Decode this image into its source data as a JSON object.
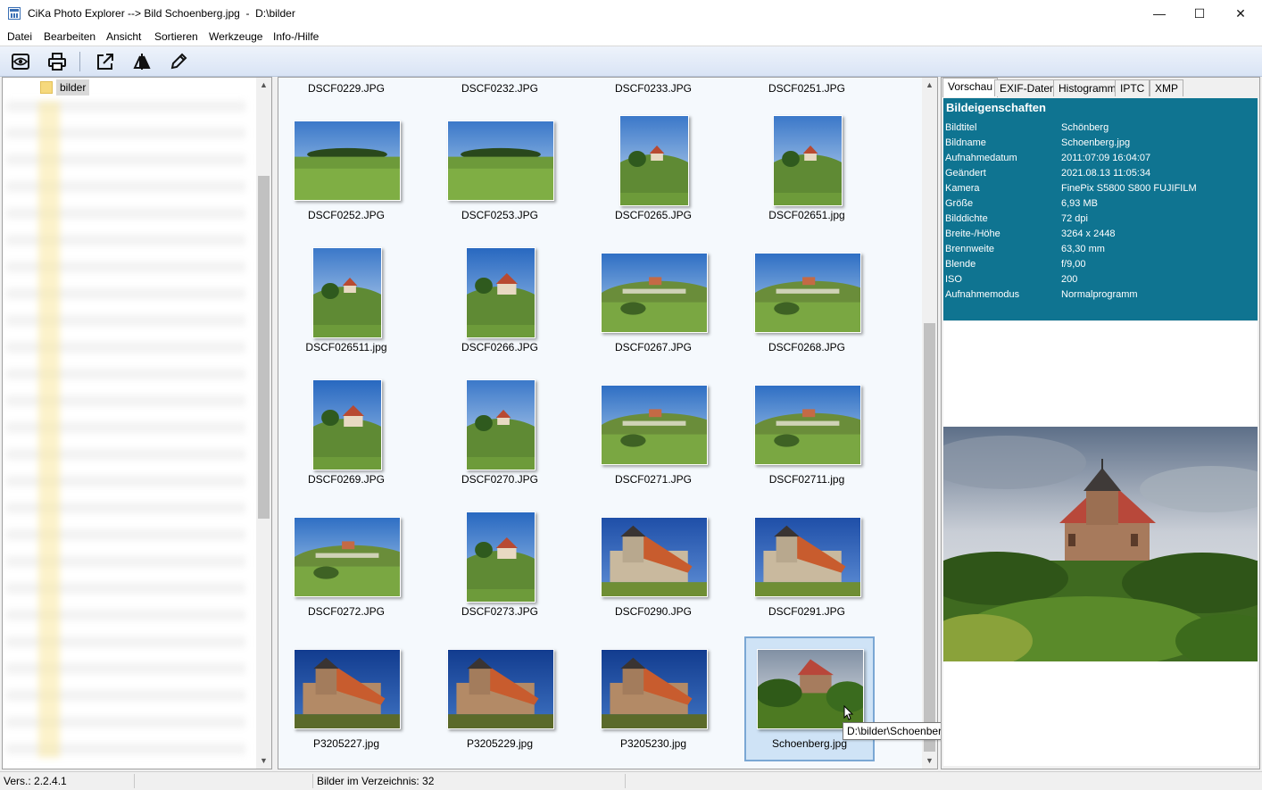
{
  "window": {
    "title": "CiKa Photo Explorer --> Bild Schoenberg.jpg  -  D:\\bilder",
    "minimize": "—",
    "maximize": "☐",
    "close": "✕"
  },
  "menu": [
    "Datei",
    "Bearbeiten",
    "Ansicht",
    "Sortieren",
    "Werkzeuge",
    "Info-/Hilfe"
  ],
  "toolbar": {
    "icons": [
      "eye-icon",
      "printer-icon",
      "external-link-icon",
      "compare-icon",
      "pencil-icon"
    ]
  },
  "tree": {
    "selected_folder": "bilder"
  },
  "grid": {
    "top_row_labels": [
      "DSCF0229.JPG",
      "DSCF0232.JPG",
      "DSCF0233.JPG",
      "DSCF0251.JPG"
    ],
    "rows": [
      [
        {
          "name": "DSCF0252.JPG",
          "scene": "hill"
        },
        {
          "name": "DSCF0253.JPG",
          "scene": "hill"
        },
        {
          "name": "DSCF0265.JPG",
          "scene": "chapel-hill"
        },
        {
          "name": "DSCF02651.jpg",
          "scene": "chapel-hill"
        }
      ],
      [
        {
          "name": "DSCF026511.jpg",
          "scene": "chapel-hill"
        },
        {
          "name": "DSCF0266.JPG",
          "scene": "chapel-close"
        },
        {
          "name": "DSCF0267.JPG",
          "scene": "village-meadow"
        },
        {
          "name": "DSCF0268.JPG",
          "scene": "village-meadow"
        }
      ],
      [
        {
          "name": "DSCF0269.JPG",
          "scene": "chapel-close"
        },
        {
          "name": "DSCF0270.JPG",
          "scene": "chapel-hill"
        },
        {
          "name": "DSCF0271.JPG",
          "scene": "village-meadow"
        },
        {
          "name": "DSCF02711.jpg",
          "scene": "village-meadow"
        }
      ],
      [
        {
          "name": "DSCF0272.JPG",
          "scene": "village-meadow"
        },
        {
          "name": "DSCF0273.JPG",
          "scene": "chapel-close"
        },
        {
          "name": "DSCF0290.JPG",
          "scene": "church"
        },
        {
          "name": "DSCF0291.JPG",
          "scene": "church"
        }
      ],
      [
        {
          "name": "P3205227.jpg",
          "scene": "church-dark"
        },
        {
          "name": "P3205229.jpg",
          "scene": "church-dark"
        },
        {
          "name": "P3205230.jpg",
          "scene": "church-dark"
        },
        {
          "name": "Schoenberg.jpg",
          "scene": "church-cloudy",
          "selected": true
        }
      ]
    ],
    "tooltip": "D:\\bilder\\Schoenberg.jpg"
  },
  "right": {
    "tabs": [
      {
        "label": "Vorschau",
        "active": true
      },
      {
        "label": "EXIF-Daten"
      },
      {
        "label": "Histogramm"
      },
      {
        "label": "IPTC"
      },
      {
        "label": "XMP"
      }
    ],
    "props_title": "Bildeigenschaften",
    "props": [
      {
        "key": "Bildtitel",
        "value": "Schönberg"
      },
      {
        "key": "Bildname",
        "value": "Schoenberg.jpg"
      },
      {
        "key": "Aufnahmedatum",
        "value": "2011:07:09 16:04:07"
      },
      {
        "key": "Geändert",
        "value": "2021.08.13 11:05:34"
      },
      {
        "key": "Kamera",
        "value": "FinePix S5800 S800 FUJIFILM"
      },
      {
        "key": "Größe",
        "value": "6,93 MB"
      },
      {
        "key": "Bilddichte",
        "value": "72 dpi"
      },
      {
        "key": "Breite-/Höhe",
        "value": "3264 x 2448"
      },
      {
        "key": "Brennweite",
        "value": "63,30 mm"
      },
      {
        "key": "Blende",
        "value": "f/9,00"
      },
      {
        "key": "ISO",
        "value": "200"
      },
      {
        "key": "Aufnahmemodus",
        "value": "Normalprogramm"
      }
    ]
  },
  "status": {
    "version": "Vers.: 2.2.4.1",
    "count": "Bilder im Verzeichnis: 32"
  },
  "colors": {
    "props_bg": "#0f7491",
    "selection": "#cfe3f6"
  }
}
